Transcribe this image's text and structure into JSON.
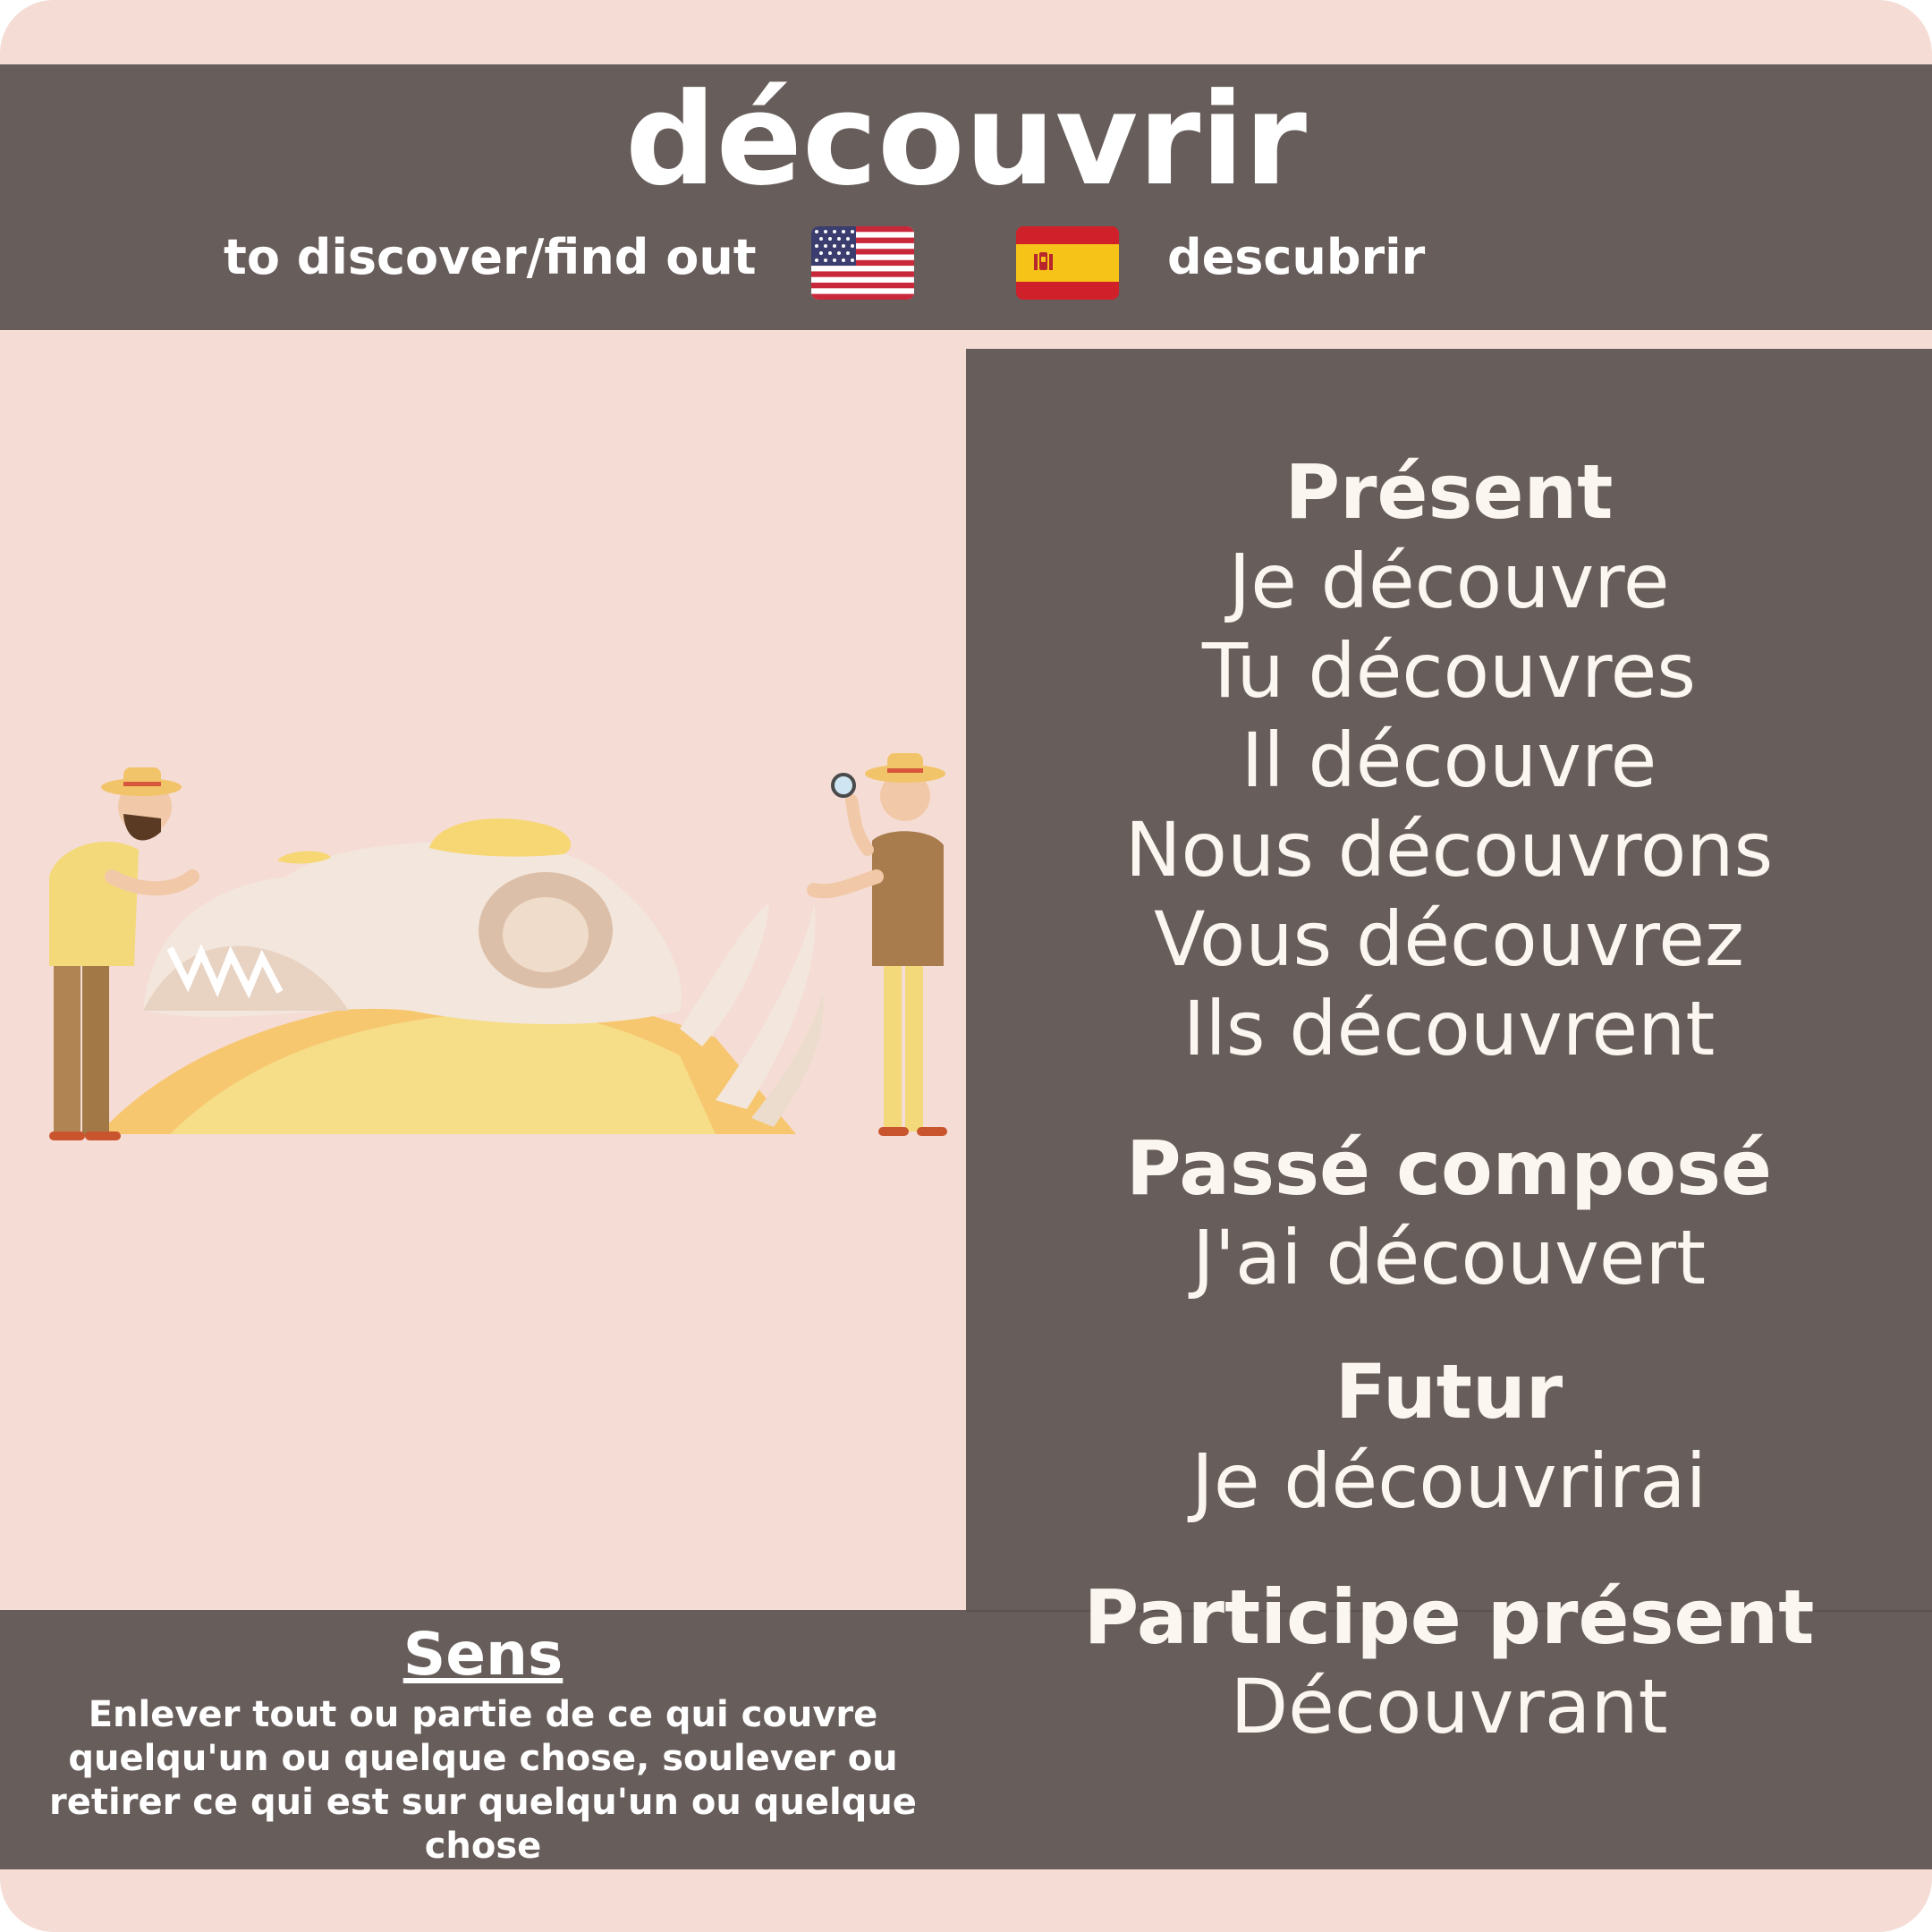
{
  "word": "découvrir",
  "translations": {
    "english": "to discover/find out",
    "spanish": "descubrir"
  },
  "flags": {
    "english_flag_icon": "us-flag-icon",
    "spanish_flag_icon": "spain-flag-icon"
  },
  "conjugation": {
    "present": {
      "heading": "Présent",
      "forms": [
        "Je découvre",
        "Tu découvres",
        "Il découvre",
        "Nous découvrons",
        "Vous découvrez",
        "Ils découvrent"
      ]
    },
    "passe_compose": {
      "heading": "Passé composé",
      "form": "J'ai découvert"
    },
    "futur": {
      "heading": "Futur",
      "form": "Je découvrirai"
    },
    "participe_present": {
      "heading": "Participe présent",
      "form": "Découvrant"
    }
  },
  "meaning": {
    "heading": "Sens",
    "text": "Enlever tout ou partie de ce qui couvre quelqu'un ou quelque chose, soulever ou retirer ce qui est sur quelqu'un ou quelque chose"
  },
  "colors": {
    "background": "#f5dcd5",
    "panel": "#675d5a",
    "text_light": "#fbf6f0"
  },
  "illustration_icon": "archaeologists-excavating-skull-illustration"
}
